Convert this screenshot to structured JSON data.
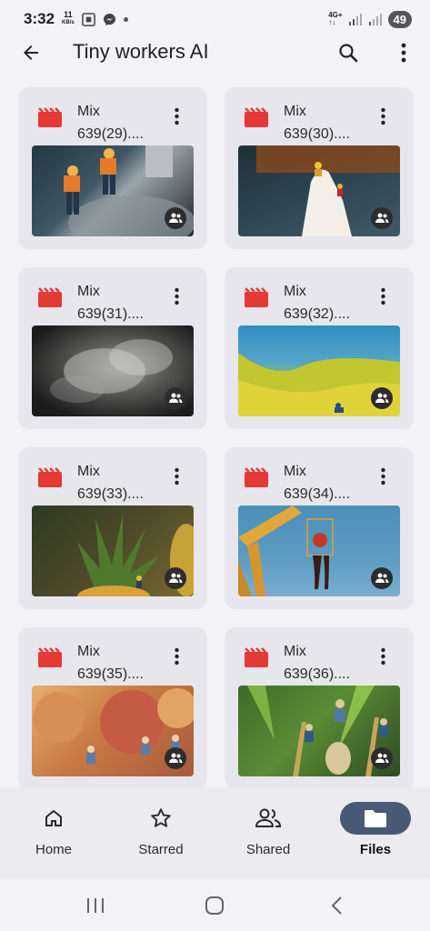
{
  "status": {
    "time": "3:32",
    "speed_value": "11",
    "speed_unit": "KB/s",
    "net_top": "4G+",
    "net_bottom": "↑↓",
    "battery": "49"
  },
  "app_bar": {
    "title": "Tiny workers AI"
  },
  "files": [
    {
      "line1": "Mix",
      "line2": "639(29)....",
      "thumb": "thumb-29"
    },
    {
      "line1": "Mix",
      "line2": "639(30)....",
      "thumb": "thumb-30"
    },
    {
      "line1": "Mix",
      "line2": "639(31)....",
      "thumb": "thumb-31"
    },
    {
      "line1": "Mix",
      "line2": "639(32)....",
      "thumb": "thumb-32"
    },
    {
      "line1": "Mix",
      "line2": "639(33)....",
      "thumb": "thumb-33"
    },
    {
      "line1": "Mix",
      "line2": "639(34)....",
      "thumb": "thumb-34"
    },
    {
      "line1": "Mix",
      "line2": "639(35)....",
      "thumb": "thumb-35"
    },
    {
      "line1": "Mix",
      "line2": "639(36)....",
      "thumb": "thumb-36"
    }
  ],
  "bottom_nav": {
    "items": [
      {
        "label": "Home",
        "icon": "home-icon"
      },
      {
        "label": "Starred",
        "icon": "star-icon"
      },
      {
        "label": "Shared",
        "icon": "shared-people-icon"
      },
      {
        "label": "Files",
        "icon": "folder-icon",
        "active": true
      }
    ]
  },
  "colors": {
    "accent": "#4a5a74",
    "video_icon": "#e53935",
    "card_bg": "#e7e6ec",
    "page_bg": "#f3f2f7"
  }
}
